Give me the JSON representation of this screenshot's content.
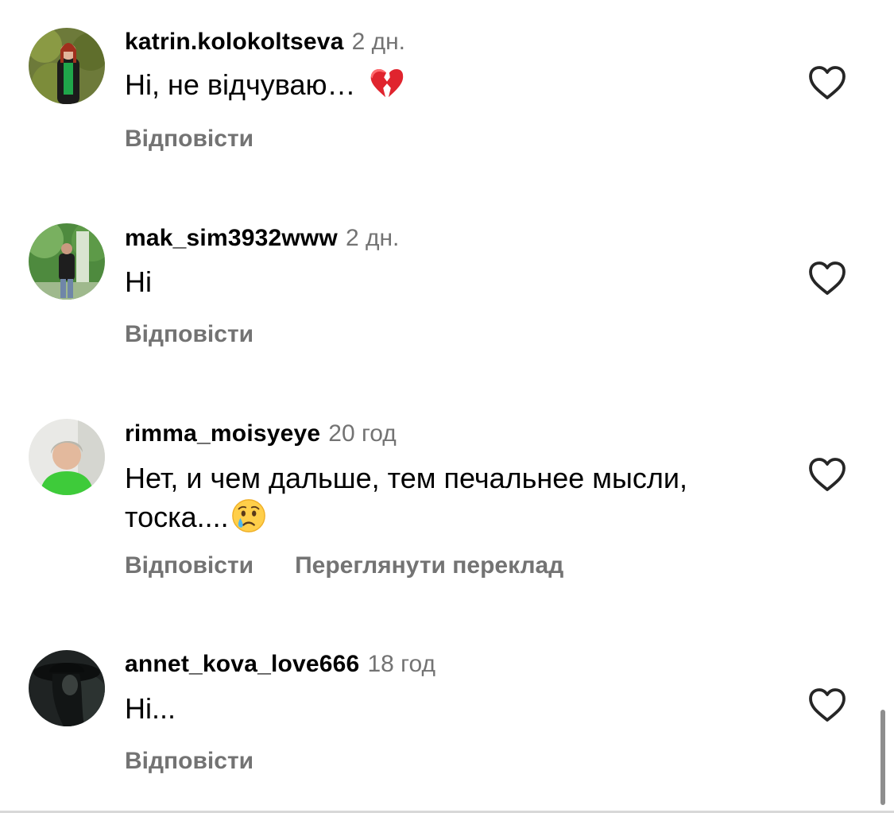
{
  "comments": [
    {
      "username": "katrin.kolokoltseva",
      "time": "2 дн.",
      "text": "Ні, не відчуваю…",
      "emoji": "broken-heart",
      "reply_label": "Відповісти"
    },
    {
      "username": "mak_sim3932www",
      "time": "2 дн.",
      "text": "Ні",
      "reply_label": "Відповісти"
    },
    {
      "username": "rimma_moisyeye",
      "time": "20 год",
      "text_line1": "Нет, и чем дальше, тем печальнее мысли,",
      "text_line2": "тоска....",
      "emoji": "crying-face",
      "reply_label": "Відповісти",
      "translate_label": "Переглянути переклад"
    },
    {
      "username": "annet_kova_love666",
      "time": "18 год",
      "text": "Ні...",
      "reply_label": "Відповісти"
    }
  ],
  "icons": {
    "like": "heart-outline-icon"
  },
  "colors": {
    "text": "#000000",
    "secondary": "#737373",
    "scrollbar": "#8e8e8e"
  }
}
